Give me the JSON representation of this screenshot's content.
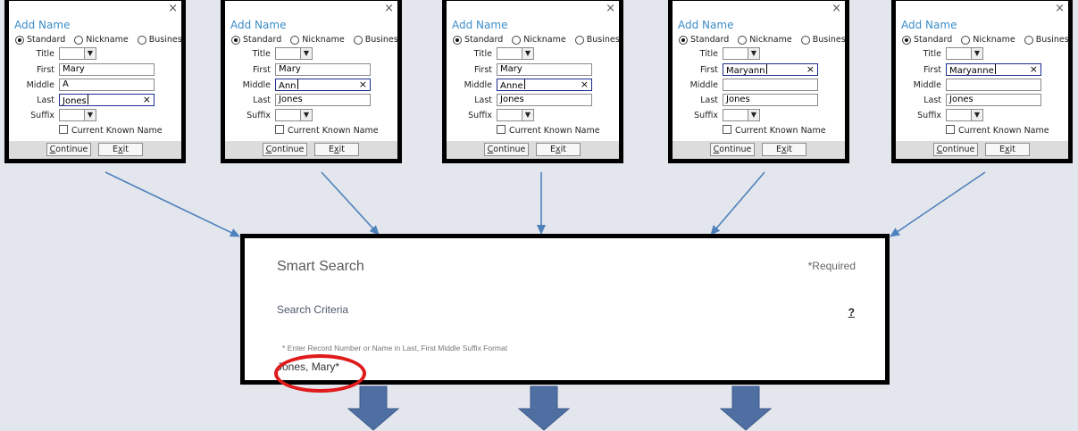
{
  "dialogs": [
    {
      "title": "Add Name",
      "close": "×",
      "radios": [
        "Standard",
        "Nickname",
        "Business"
      ],
      "selected": "Standard",
      "fields": {
        "title": "Title",
        "first": "First",
        "middle": "Middle",
        "last": "Last",
        "suffix": "Suffix"
      },
      "values": {
        "first": "Mary",
        "middle": "A",
        "last": "Jones"
      },
      "clear_icon": "×",
      "checkbox": "Current Known Name",
      "buttons": {
        "continue": "Continue",
        "exit": "Exit"
      }
    },
    {
      "title": "Add Name",
      "close": "×",
      "radios": [
        "Standard",
        "Nickname",
        "Business"
      ],
      "selected": "Standard",
      "fields": {
        "title": "Title",
        "first": "First",
        "middle": "Middle",
        "last": "Last",
        "suffix": "Suffix"
      },
      "values": {
        "first": "Mary",
        "middle": "Ann",
        "last": "Jones"
      },
      "clear_icon": "×",
      "checkbox": "Current Known Name",
      "buttons": {
        "continue": "Continue",
        "exit": "Exit"
      }
    },
    {
      "title": "Add Name",
      "close": "×",
      "radios": [
        "Standard",
        "Nickname",
        "Business"
      ],
      "selected": "Standard",
      "fields": {
        "title": "Title",
        "first": "First",
        "middle": "Middle",
        "last": "Last",
        "suffix": "Suffix"
      },
      "values": {
        "first": "Mary",
        "middle": "Anne",
        "last": "Jones"
      },
      "clear_icon": "×",
      "checkbox": "Current Known Name",
      "buttons": {
        "continue": "Continue",
        "exit": "Exit"
      }
    },
    {
      "title": "Add Name",
      "close": "×",
      "radios": [
        "Standard",
        "Nickname",
        "Business"
      ],
      "selected": "Standard",
      "fields": {
        "title": "Title",
        "first": "First",
        "middle": "Middle",
        "last": "Last",
        "suffix": "Suffix"
      },
      "values": {
        "first": "Maryann",
        "middle": "",
        "last": "Jones"
      },
      "clear_icon": "×",
      "checkbox": "Current Known Name",
      "buttons": {
        "continue": "Continue",
        "exit": "Exit"
      }
    },
    {
      "title": "Add Name",
      "close": "×",
      "radios": [
        "Standard",
        "Nickname",
        "Business"
      ],
      "selected": "Standard",
      "fields": {
        "title": "Title",
        "first": "First",
        "middle": "Middle",
        "last": "Last",
        "suffix": "Suffix"
      },
      "values": {
        "first": "Maryanne",
        "middle": "",
        "last": "Jones"
      },
      "clear_icon": "×",
      "checkbox": "Current Known Name",
      "buttons": {
        "continue": "Continue",
        "exit": "Exit"
      }
    }
  ],
  "search": {
    "title": "Smart Search",
    "required": "*Required",
    "criteria": "Search Criteria",
    "help": "?",
    "hint": "* Enter Record Number or Name in Last, First Middle Suffix Format",
    "value": "Jones, Mary*"
  },
  "colors": {
    "background": "#e3e6ec",
    "connector": "#4f81bd",
    "big_arrow": "#4f6fa3",
    "highlight": "#e01b1b",
    "dialog_title": "#3c8dc8"
  }
}
